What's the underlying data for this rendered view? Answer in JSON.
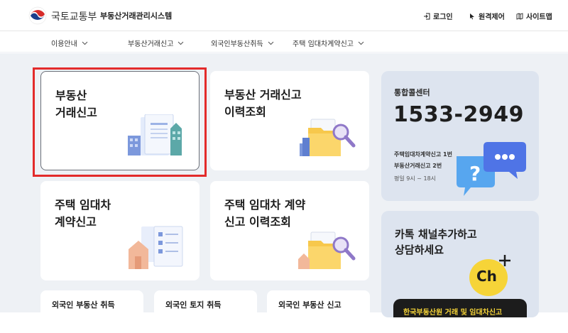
{
  "header": {
    "ministry": "국토교통부",
    "system_name": "부동산거래관리시스템",
    "utilities": [
      {
        "label": "로그인",
        "icon": "login-icon"
      },
      {
        "label": "원격제어",
        "icon": "cursor-icon"
      },
      {
        "label": "사이트맵",
        "icon": "map-icon"
      }
    ]
  },
  "nav": {
    "items": [
      {
        "label": "이용안내"
      },
      {
        "label": "부동산거래신고"
      },
      {
        "label": "외국인부동산취득"
      },
      {
        "label": "주택 임대차계약신고"
      }
    ]
  },
  "cards": [
    {
      "title": "부동산\n거래신고",
      "illustration": "buildings-document-icon"
    },
    {
      "title": "부동산 거래신고\n이력조회",
      "illustration": "folder-search-icon"
    },
    {
      "title": "주택 임대차\n계약신고",
      "illustration": "house-checklist-icon"
    },
    {
      "title": "주택 임대차 계약\n신고 이력조회",
      "illustration": "folder-search-icon"
    }
  ],
  "small_cards": [
    {
      "title": "외국인 부동산 취득"
    },
    {
      "title": "외국인 토지 취득"
    },
    {
      "title": "외국인 부동산 신고"
    }
  ],
  "call_center": {
    "title": "통합콜센터",
    "number": "1533-2949",
    "lines": [
      "주택임대차계약신고 1번",
      "부동산거래신고 2번"
    ],
    "hours": "평일 9시 ~ 18시"
  },
  "kakao": {
    "title": "카톡 채널추가하고\n상담하세요",
    "badge": "Ch",
    "banner": "한국부동산원 거래 및 임대차신고"
  },
  "colors": {
    "highlight": "#e32b2b",
    "background": "#eef1f5",
    "kakao_yellow": "#f6d438"
  }
}
